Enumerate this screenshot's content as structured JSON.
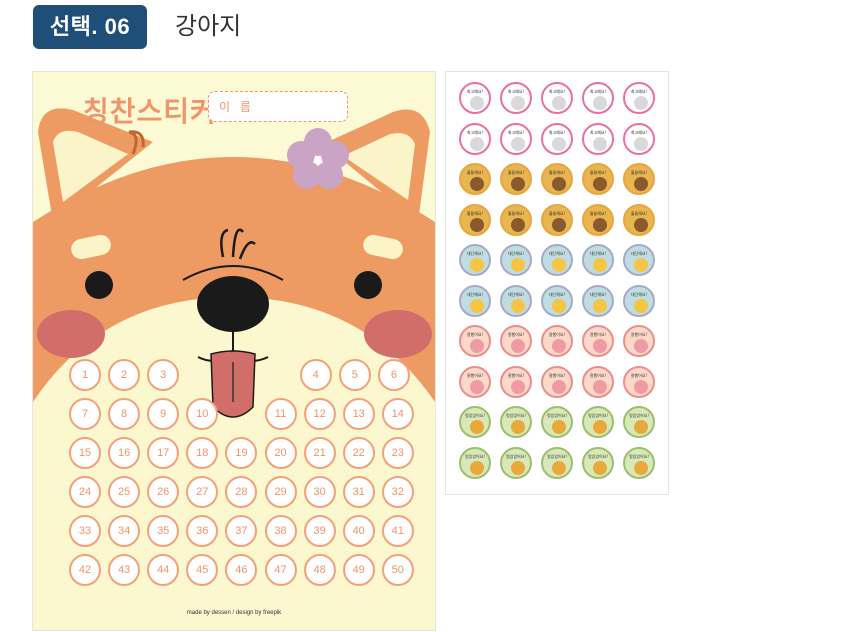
{
  "option": {
    "badge": "선택. 06",
    "title": "강아지"
  },
  "poster": {
    "title": "칭찬스티커",
    "name_placeholder": "이 름",
    "numbers": [
      "1",
      "2",
      "3",
      "4",
      "5",
      "6",
      "7",
      "8",
      "9",
      "10",
      "11",
      "12",
      "13",
      "14",
      "15",
      "16",
      "17",
      "18",
      "19",
      "20",
      "21",
      "22",
      "23",
      "24",
      "25",
      "26",
      "27",
      "28",
      "29",
      "30",
      "31",
      "32",
      "33",
      "34",
      "35",
      "36",
      "37",
      "38",
      "39",
      "40",
      "41",
      "42",
      "43",
      "44",
      "45",
      "46",
      "47",
      "48",
      "49",
      "50"
    ],
    "credit": "made by dessen / design by freepik",
    "colors": {
      "fur": "#ee9b63",
      "cream": "#fcf9d5",
      "flower": "#c9a4c4",
      "cheek": "#d26e6a"
    }
  },
  "sheet": {
    "rows": [
      {
        "label": "최고예요!",
        "border": "#e96fa6",
        "bg": "#ffffff",
        "face": "#d9d9d9",
        "icon": "sheep-icon"
      },
      {
        "label": "최고예요!",
        "border": "#e96fa6",
        "bg": "#ffffff",
        "face": "#d9d9d9",
        "icon": "sheep-icon"
      },
      {
        "label": "훌륭해요!",
        "border": "#e7a63e",
        "bg": "#e8b550",
        "face": "#8a5a2e",
        "icon": "bear-icon"
      },
      {
        "label": "훌륭해요!",
        "border": "#e7a63e",
        "bg": "#e8b550",
        "face": "#8a5a2e",
        "icon": "bear-icon"
      },
      {
        "label": "대단해요!",
        "border": "#a8a8c8",
        "bg": "#bfdde0",
        "face": "#f5c543",
        "icon": "chick-icon"
      },
      {
        "label": "대단해요!",
        "border": "#a8a8c8",
        "bg": "#bfdde0",
        "face": "#f5c543",
        "icon": "chick-icon"
      },
      {
        "label": "잘했어요!",
        "border": "#eb8e8e",
        "bg": "#fbd8c8",
        "face": "#f09aa5",
        "icon": "pig-icon"
      },
      {
        "label": "잘했어요!",
        "border": "#eb8e8e",
        "bg": "#fbd8c8",
        "face": "#f09aa5",
        "icon": "pig-icon"
      },
      {
        "label": "멋있었어요!",
        "border": "#9bbf6b",
        "bg": "#d8e8b8",
        "face": "#e9a93a",
        "icon": "lion-icon"
      },
      {
        "label": "멋있었어요!",
        "border": "#9bbf6b",
        "bg": "#d8e8b8",
        "face": "#e9a93a",
        "icon": "lion-icon"
      }
    ],
    "columns": 5
  }
}
